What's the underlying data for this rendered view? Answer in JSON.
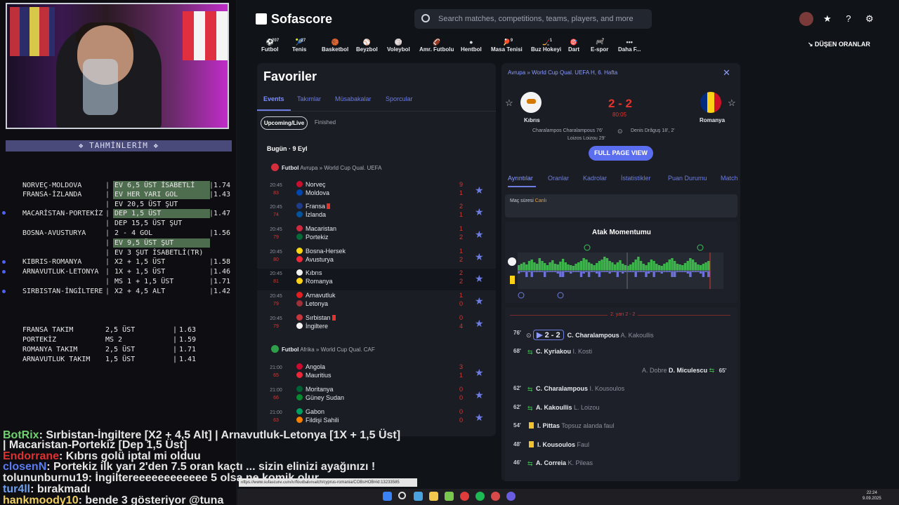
{
  "stream": {
    "tahmin_title": "❖ TAHMİNLERİM ❖",
    "bets": [
      {
        "match": "NORVEÇ-MOLDOVA",
        "pick": "EV 6,5 ÜST İSABETLİ",
        "odds": "1.74",
        "hl": true
      },
      {
        "match": "FRANSA-İZLANDA",
        "pick": "EV HER YARI GOL",
        "odds": "1.43",
        "hl": true
      },
      {
        "match": "",
        "pick": "EV 20,5 ÜST ŞUT",
        "odds": "",
        "hl": false
      },
      {
        "match": "MACARİSTAN-PORTEKİZ",
        "pick": "DEP 1,5 ÜST",
        "odds": "1.47",
        "hl": true
      },
      {
        "match": "",
        "pick": "DEP 15,5 ÜST ŞUT",
        "odds": "",
        "hl": false
      },
      {
        "match": "BOSNA-AVUSTURYA",
        "pick": "2 - 4 GOL",
        "odds": "1.56",
        "hl": false
      },
      {
        "match": "",
        "pick": "EV 9,5 ÜST ŞUT",
        "odds": "",
        "hl": true
      },
      {
        "match": "",
        "pick": "EV 3 ŞUT İSABETLİ(TR)",
        "odds": "",
        "hl": false
      },
      {
        "match": "KIBRIS-ROMANYA",
        "pick": "X2 + 1,5 ÜST",
        "odds": "1.58",
        "hl": false
      },
      {
        "match": "ARNAVUTLUK-LETONYA",
        "pick": "1X + 1,5 ÜST",
        "odds": "1.46",
        "hl": false
      },
      {
        "match": "",
        "pick": "MS 1 + 1,5 ÜST",
        "odds": "1.71",
        "hl": false
      },
      {
        "match": "SIRBISTAN-İNGİLTERE",
        "pick": "X2 + 4,5 ALT",
        "odds": "1.42",
        "hl": false
      }
    ],
    "takim": [
      {
        "name": "FRANSA TAKIM",
        "val": "2,5 ÜST",
        "odds": "1.63"
      },
      {
        "name": "PORTEKİZ",
        "val": "MS 2",
        "odds": "1.59"
      },
      {
        "name": "ROMANYA TAKIM",
        "val": "2,5 ÜST",
        "odds": "1.71"
      },
      {
        "name": "ARNAVUTLUK TAKIM",
        "val": "1,5 ÜST",
        "odds": "1.41"
      }
    ],
    "chat": [
      {
        "user": "BotRix",
        "msg": ": Sırbistan-İngiltere [X2 + 4,5 Alt] | Arnavutluk-Letonya [1X + 1,5 Üst]",
        "color": "#6fd16f"
      },
      {
        "user": "",
        "msg": "| Macaristan-Portekiz [Dep 1,5 Üst]",
        "color": "#e6e6e6"
      },
      {
        "user": "Endorrane",
        "msg": ": Kıbrıs golü iptal mi olduu",
        "color": "#e03030"
      },
      {
        "user": "closenN",
        "msg": ": Portekiz ilk yarı 2'den 7.5 oran kaçtı ... sizin elinizi ayağınızı !",
        "color": "#5a7cf0"
      },
      {
        "user": "tolununburnu19",
        "msg": ": İngiltereeeeeeeeeeee 5 olsa ne komik olur",
        "color": "#e6e6e6"
      },
      {
        "user": "tur4ll",
        "msg": ": bırakmadı",
        "color": "#6fa0f0"
      },
      {
        "user": "hankmoody10",
        "msg": ": bende 3 gösteriyor @tuna",
        "color": "#f0d060"
      }
    ]
  },
  "topbar": {
    "logo": "Sofascore",
    "search_placeholder": "Search matches, competitions, teams, players, and more",
    "sports": [
      {
        "label": "Futbol",
        "count": "207",
        "glyph": "⚽"
      },
      {
        "label": "Tenis",
        "count": "27",
        "glyph": "🎾"
      },
      {
        "label": "Basketbol",
        "count": "",
        "glyph": "🏀"
      },
      {
        "label": "Beyzbol",
        "count": "",
        "glyph": "⚾"
      },
      {
        "label": "Voleybol",
        "count": "",
        "glyph": "🏐"
      },
      {
        "label": "Amr. Futbolu",
        "count": "",
        "glyph": "🏈"
      },
      {
        "label": "Hentbol",
        "count": "",
        "glyph": "●"
      },
      {
        "label": "Masa Tenisi",
        "count": "9",
        "glyph": "🏓"
      },
      {
        "label": "Buz Hokeyi",
        "count": "1",
        "glyph": "🏒"
      },
      {
        "label": "Dart",
        "count": "",
        "glyph": "🎯"
      },
      {
        "label": "E-spor",
        "count": "7",
        "glyph": "🎮"
      },
      {
        "label": "Daha F...",
        "count": "",
        "glyph": "•••"
      }
    ],
    "dusen": "DÜŞEN ORANLAR"
  },
  "fav": {
    "title": "Favoriler",
    "tabs": [
      "Events",
      "Takımlar",
      "Müsabakalar",
      "Sporcular"
    ],
    "chips": [
      "Upcoming/Live",
      "Finished"
    ],
    "today": "Bugün · 9 Eyl",
    "league1": {
      "sport": "Futbol",
      "path": "Avrupa » World Cup Qual. UEFA"
    },
    "league2": {
      "sport": "Futbol",
      "path": "Afrika » World Cup Qual. CAF"
    },
    "matches": [
      {
        "time": "20:45",
        "min": "83",
        "home": "Norveç",
        "away": "Moldova",
        "hs": "9",
        "as": "1",
        "hc": "#c8102e",
        "ac": "#0046ae",
        "red_h": false,
        "red_a": false
      },
      {
        "time": "20:45",
        "min": "74",
        "home": "Fransa",
        "away": "İzlanda",
        "hs": "2",
        "as": "1",
        "hc": "#1e3c8a",
        "ac": "#02529c",
        "red_h": true,
        "red_a": false
      },
      {
        "time": "20:45",
        "min": "79",
        "home": "Macaristan",
        "away": "Portekiz",
        "hs": "1",
        "as": "2",
        "hc": "#cd2a3e",
        "ac": "#046a38",
        "red_h": false,
        "red_a": false
      },
      {
        "time": "20:45",
        "min": "80",
        "home": "Bosna-Hersek",
        "away": "Avusturya",
        "hs": "1",
        "as": "2",
        "hc": "#f9d616",
        "ac": "#ed2939",
        "red_h": false,
        "red_a": false
      },
      {
        "time": "20:45",
        "min": "81",
        "home": "Kıbrıs",
        "away": "Romanya",
        "hs": "2",
        "as": "2",
        "hc": "#f0f0f0",
        "ac": "#fcd116",
        "red_h": false,
        "red_a": false
      },
      {
        "time": "20:45",
        "min": "79",
        "home": "Arnavutluk",
        "away": "Letonya",
        "hs": "1",
        "as": "0",
        "hc": "#e41e20",
        "ac": "#9e3039",
        "red_h": false,
        "red_a": false
      },
      {
        "time": "20:45",
        "min": "79",
        "home": "Sırbistan",
        "away": "İngiltere",
        "hs": "0",
        "as": "4",
        "hc": "#c6363c",
        "ac": "#f4f4f4",
        "red_h": true,
        "red_a": false
      }
    ],
    "matches2": [
      {
        "time": "21:00",
        "min": "65",
        "home": "Angola",
        "away": "Mauritius",
        "hs": "3",
        "as": "1",
        "hc": "#cc092f",
        "ac": "#ea2839"
      },
      {
        "time": "21:00",
        "min": "66",
        "home": "Moritanya",
        "away": "Güney Sudan",
        "hs": "0",
        "as": "0",
        "hc": "#006233",
        "ac": "#078930"
      },
      {
        "time": "21:00",
        "min": "63",
        "home": "Gabon",
        "away": "Fildişi Sahili",
        "hs": "0",
        "as": "0",
        "hc": "#009e60",
        "ac": "#f77f00"
      }
    ]
  },
  "detail": {
    "crumb": "Avrupa  »  World Cup Qual. UEFA H, 6. Hafta",
    "home": "Kıbrıs",
    "away": "Romanya",
    "score": "2 - 2",
    "clock": "80:05",
    "home_scorers": [
      "Charalampos Charalampous 76'",
      "Loizos Loizou 29'"
    ],
    "away_scorers": [
      "Denis Drăguş 18', 2'"
    ],
    "full_page": "FULL PAGE VIEW",
    "tabs": [
      "Ayrıntılar",
      "Oranlar",
      "Kadrolar",
      "İstatistikler",
      "Puan Durumu",
      "Match"
    ],
    "mac_suresi": "Maç süresi",
    "canli": "Canlı",
    "momentum_title": "Atak Momentumu",
    "halftime": "2. yarı 2 - 2",
    "events": [
      {
        "min": "76'",
        "score": "2 - 2",
        "name": "C. Charalampous",
        "sub": "A. Kakoullis",
        "side": "home",
        "kind": "goal"
      },
      {
        "min": "68'",
        "score": "",
        "name": "C. Kyriakou",
        "sub": "I. Kosti",
        "side": "home",
        "kind": "subst"
      },
      {
        "min": "65'",
        "score": "",
        "name": "D. Miculescu",
        "sub": "A. Dobre",
        "side": "away",
        "kind": "subst"
      },
      {
        "min": "62'",
        "score": "",
        "name": "C. Charalampous",
        "sub": "I. Kousoulos",
        "side": "home",
        "kind": "subst"
      },
      {
        "min": "62'",
        "score": "",
        "name": "A. Kakoullis",
        "sub": "L. Loizou",
        "side": "home",
        "kind": "subst"
      },
      {
        "min": "54'",
        "score": "",
        "name": "I. Pittas",
        "sub": "Topsuz alanda faul",
        "side": "home",
        "kind": "card"
      },
      {
        "min": "48'",
        "score": "",
        "name": "I. Kousoulos",
        "sub": "Faul",
        "side": "home",
        "kind": "card"
      },
      {
        "min": "46'",
        "score": "",
        "name": "A. Correia",
        "sub": "K. Pileas",
        "side": "home",
        "kind": "subst"
      }
    ]
  },
  "status_url": "https://www.sofascore.com/tr/football/match/cyprus-romania/COBsHOB#id:13233585",
  "clock": {
    "time": "22:24",
    "date": "9.09.2025"
  }
}
